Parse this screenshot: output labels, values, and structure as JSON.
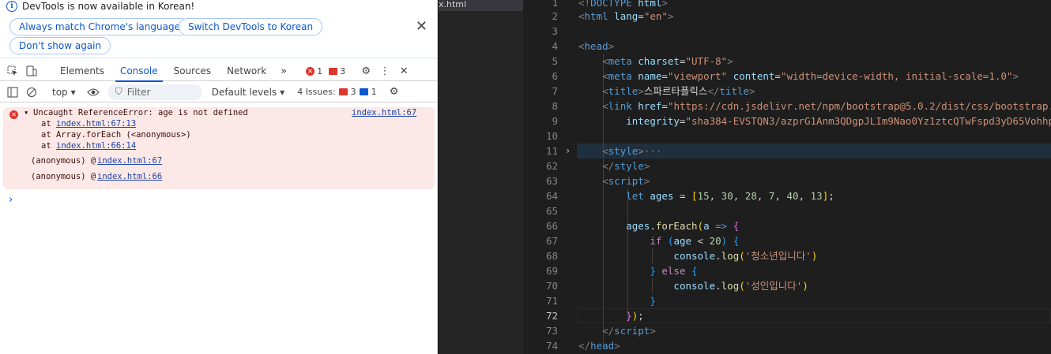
{
  "devtools": {
    "banner": {
      "message": "DevTools is now available in Korean!",
      "btn_match": "Always match Chrome's language",
      "btn_switch": "Switch DevTools to Korean",
      "btn_dont_show": "Don't show again"
    },
    "tabs": [
      "Elements",
      "Console",
      "Sources",
      "Network"
    ],
    "errors_count": "1",
    "warnings_count": "3",
    "toolbar": {
      "context": "top",
      "filter_placeholder": "Filter",
      "levels": "Default levels",
      "issues_label": "4 Issues:",
      "issues_warn": "3",
      "issues_info": "1"
    },
    "console": {
      "error": "Uncaught ReferenceError: age is not defined",
      "error_link": "index.html:67",
      "stack1_prefix": "at ",
      "stack1_link": "index.html:67:13",
      "stack2": "at Array.forEach (<anonymous>)",
      "stack3_prefix": "at ",
      "stack3_link": "index.html:66:14",
      "anon1_prefix": "(anonymous) @ ",
      "anon1_link": "index.html:67",
      "anon2_prefix": "(anonymous) @ ",
      "anon2_link": "index.html:66"
    }
  },
  "editor": {
    "tab_label": "x.html",
    "line_numbers": [
      "1",
      "2",
      "3",
      "4",
      "5",
      "6",
      "7",
      "8",
      "9",
      "10",
      "11",
      "62",
      "63",
      "64",
      "65",
      "66",
      "67",
      "68",
      "69",
      "70",
      "71",
      "72",
      "73",
      "74"
    ],
    "current_line": "72"
  }
}
